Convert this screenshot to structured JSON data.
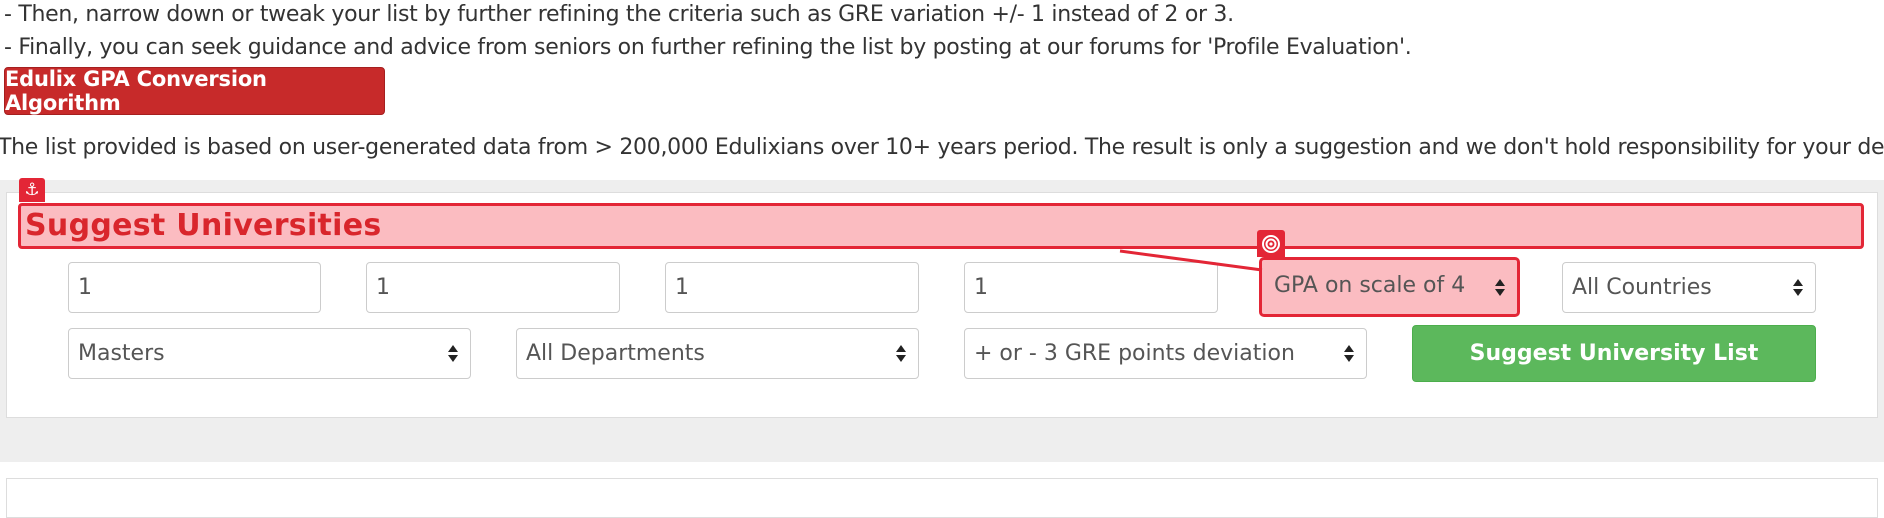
{
  "intro": {
    "line1": "- Then, narrow down or tweak your list by further refining the criteria such as GRE variation +/- 1 instead of 2 or 3.",
    "line2": "- Finally, you can seek guidance and advice from seniors on further refining the list by posting at our forums for 'Profile Evaluation'."
  },
  "conversion_button_label": "Edulix GPA Conversion Algorithm",
  "disclaimer": "The list provided is based on user-generated data from > 200,000 Edulixians over 10+ years period. The result is only a suggestion and we don't hold responsibility for your decision!",
  "panel": {
    "title": "Suggest Universities"
  },
  "form": {
    "input1": "1",
    "input2": "1",
    "input3": "1",
    "input4": "1",
    "gpa_scale": "GPA on scale of 4",
    "country": "All Countries",
    "degree": "Masters",
    "department": "All Departments",
    "gre_deviation": "+ or - 3 GRE points deviation",
    "submit_label": "Suggest University List"
  },
  "icons": {
    "anchor": "anchor-icon",
    "target": "target-icon"
  },
  "colors": {
    "brand_red": "#c72a2a",
    "highlight_red": "#e32636",
    "highlight_fill": "#fbbcc1",
    "success_green": "#5cb85c"
  }
}
